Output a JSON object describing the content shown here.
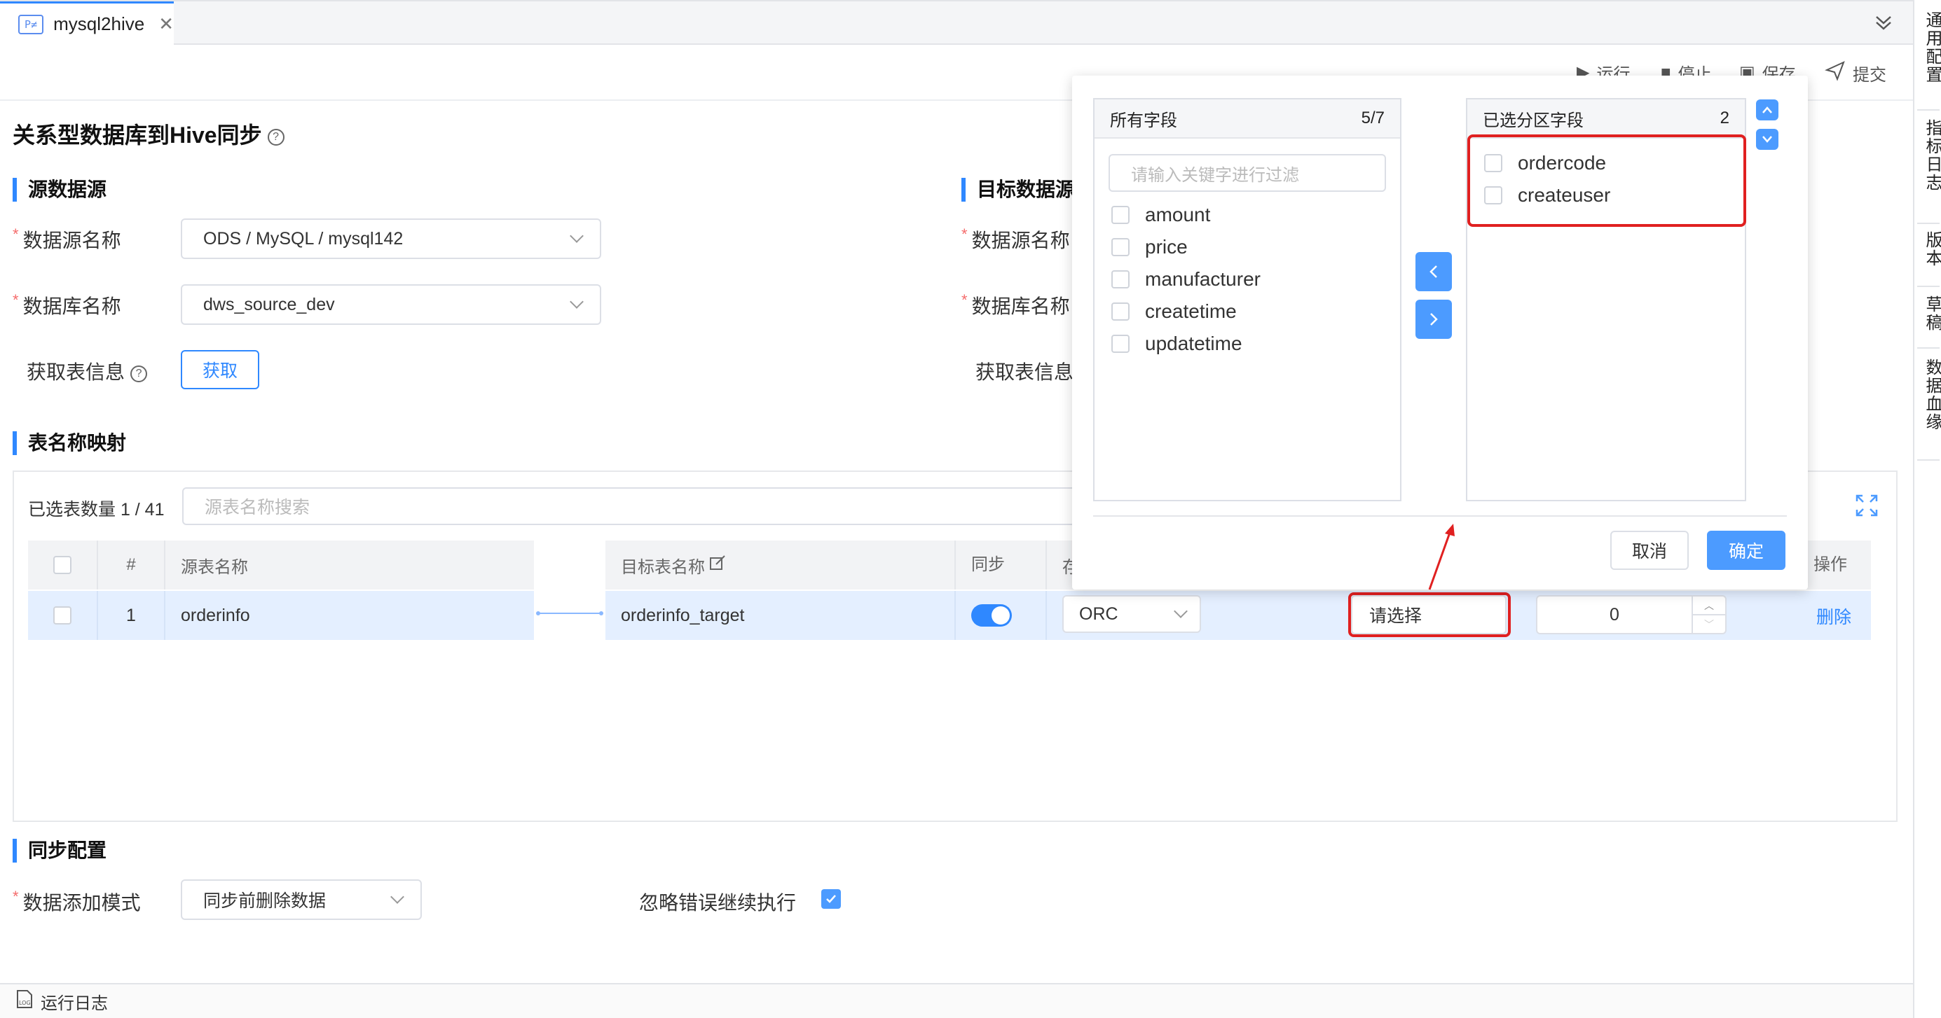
{
  "tab": {
    "name": "mysql2hive",
    "logo": "P≠"
  },
  "toolbar": {
    "run": "运行",
    "stop": "停止",
    "save": "保存",
    "submit": "提交"
  },
  "right_sidebar": [
    "通用配置",
    "指标日志",
    "版本",
    "草稿",
    "数据血缘"
  ],
  "page_title": "关系型数据库到Hive同步",
  "source": {
    "section": "源数据源",
    "datasource_label": "数据源名称",
    "datasource_value": "ODS / MySQL / mysql142",
    "database_label": "数据库名称",
    "database_value": "dws_source_dev",
    "fetch_label": "获取表信息",
    "fetch_button": "获取"
  },
  "target": {
    "section": "目标数据源",
    "datasource_label": "数据源名称",
    "database_label": "数据库名称",
    "fetch_label": "获取表信息"
  },
  "mapping": {
    "section": "表名称映射",
    "selected_count": "已选表数量 1 / 41",
    "search_placeholder": "源表名称搜索",
    "columns": {
      "index": "#",
      "source": "源表名称",
      "target": "目标表名称",
      "sync": "同步",
      "storage": "存",
      "operation": "操作"
    },
    "row": {
      "index": "1",
      "source": "orderinfo",
      "target": "orderinfo_target",
      "storage": "ORC",
      "partition": "请选择",
      "number": "0",
      "delete": "删除"
    }
  },
  "sync_config": {
    "section": "同步配置",
    "mode_label": "数据添加模式",
    "mode_value": "同步前删除数据",
    "ignore_label": "忽略错误继续执行"
  },
  "transfer": {
    "left_title": "所有字段",
    "left_count": "5/7",
    "filter_placeholder": "请输入关键字进行过滤",
    "left_items": [
      "amount",
      "price",
      "manufacturer",
      "createtime",
      "updatetime"
    ],
    "right_title": "已选分区字段",
    "right_count": "2",
    "right_items": [
      "ordercode",
      "createuser"
    ],
    "cancel": "取消",
    "confirm": "确定"
  },
  "statusbar": {
    "log": "运行日志"
  },
  "colors": {
    "accent": "#2f88ff",
    "highlight": "#e02020",
    "row_bg": "#e4efff"
  }
}
